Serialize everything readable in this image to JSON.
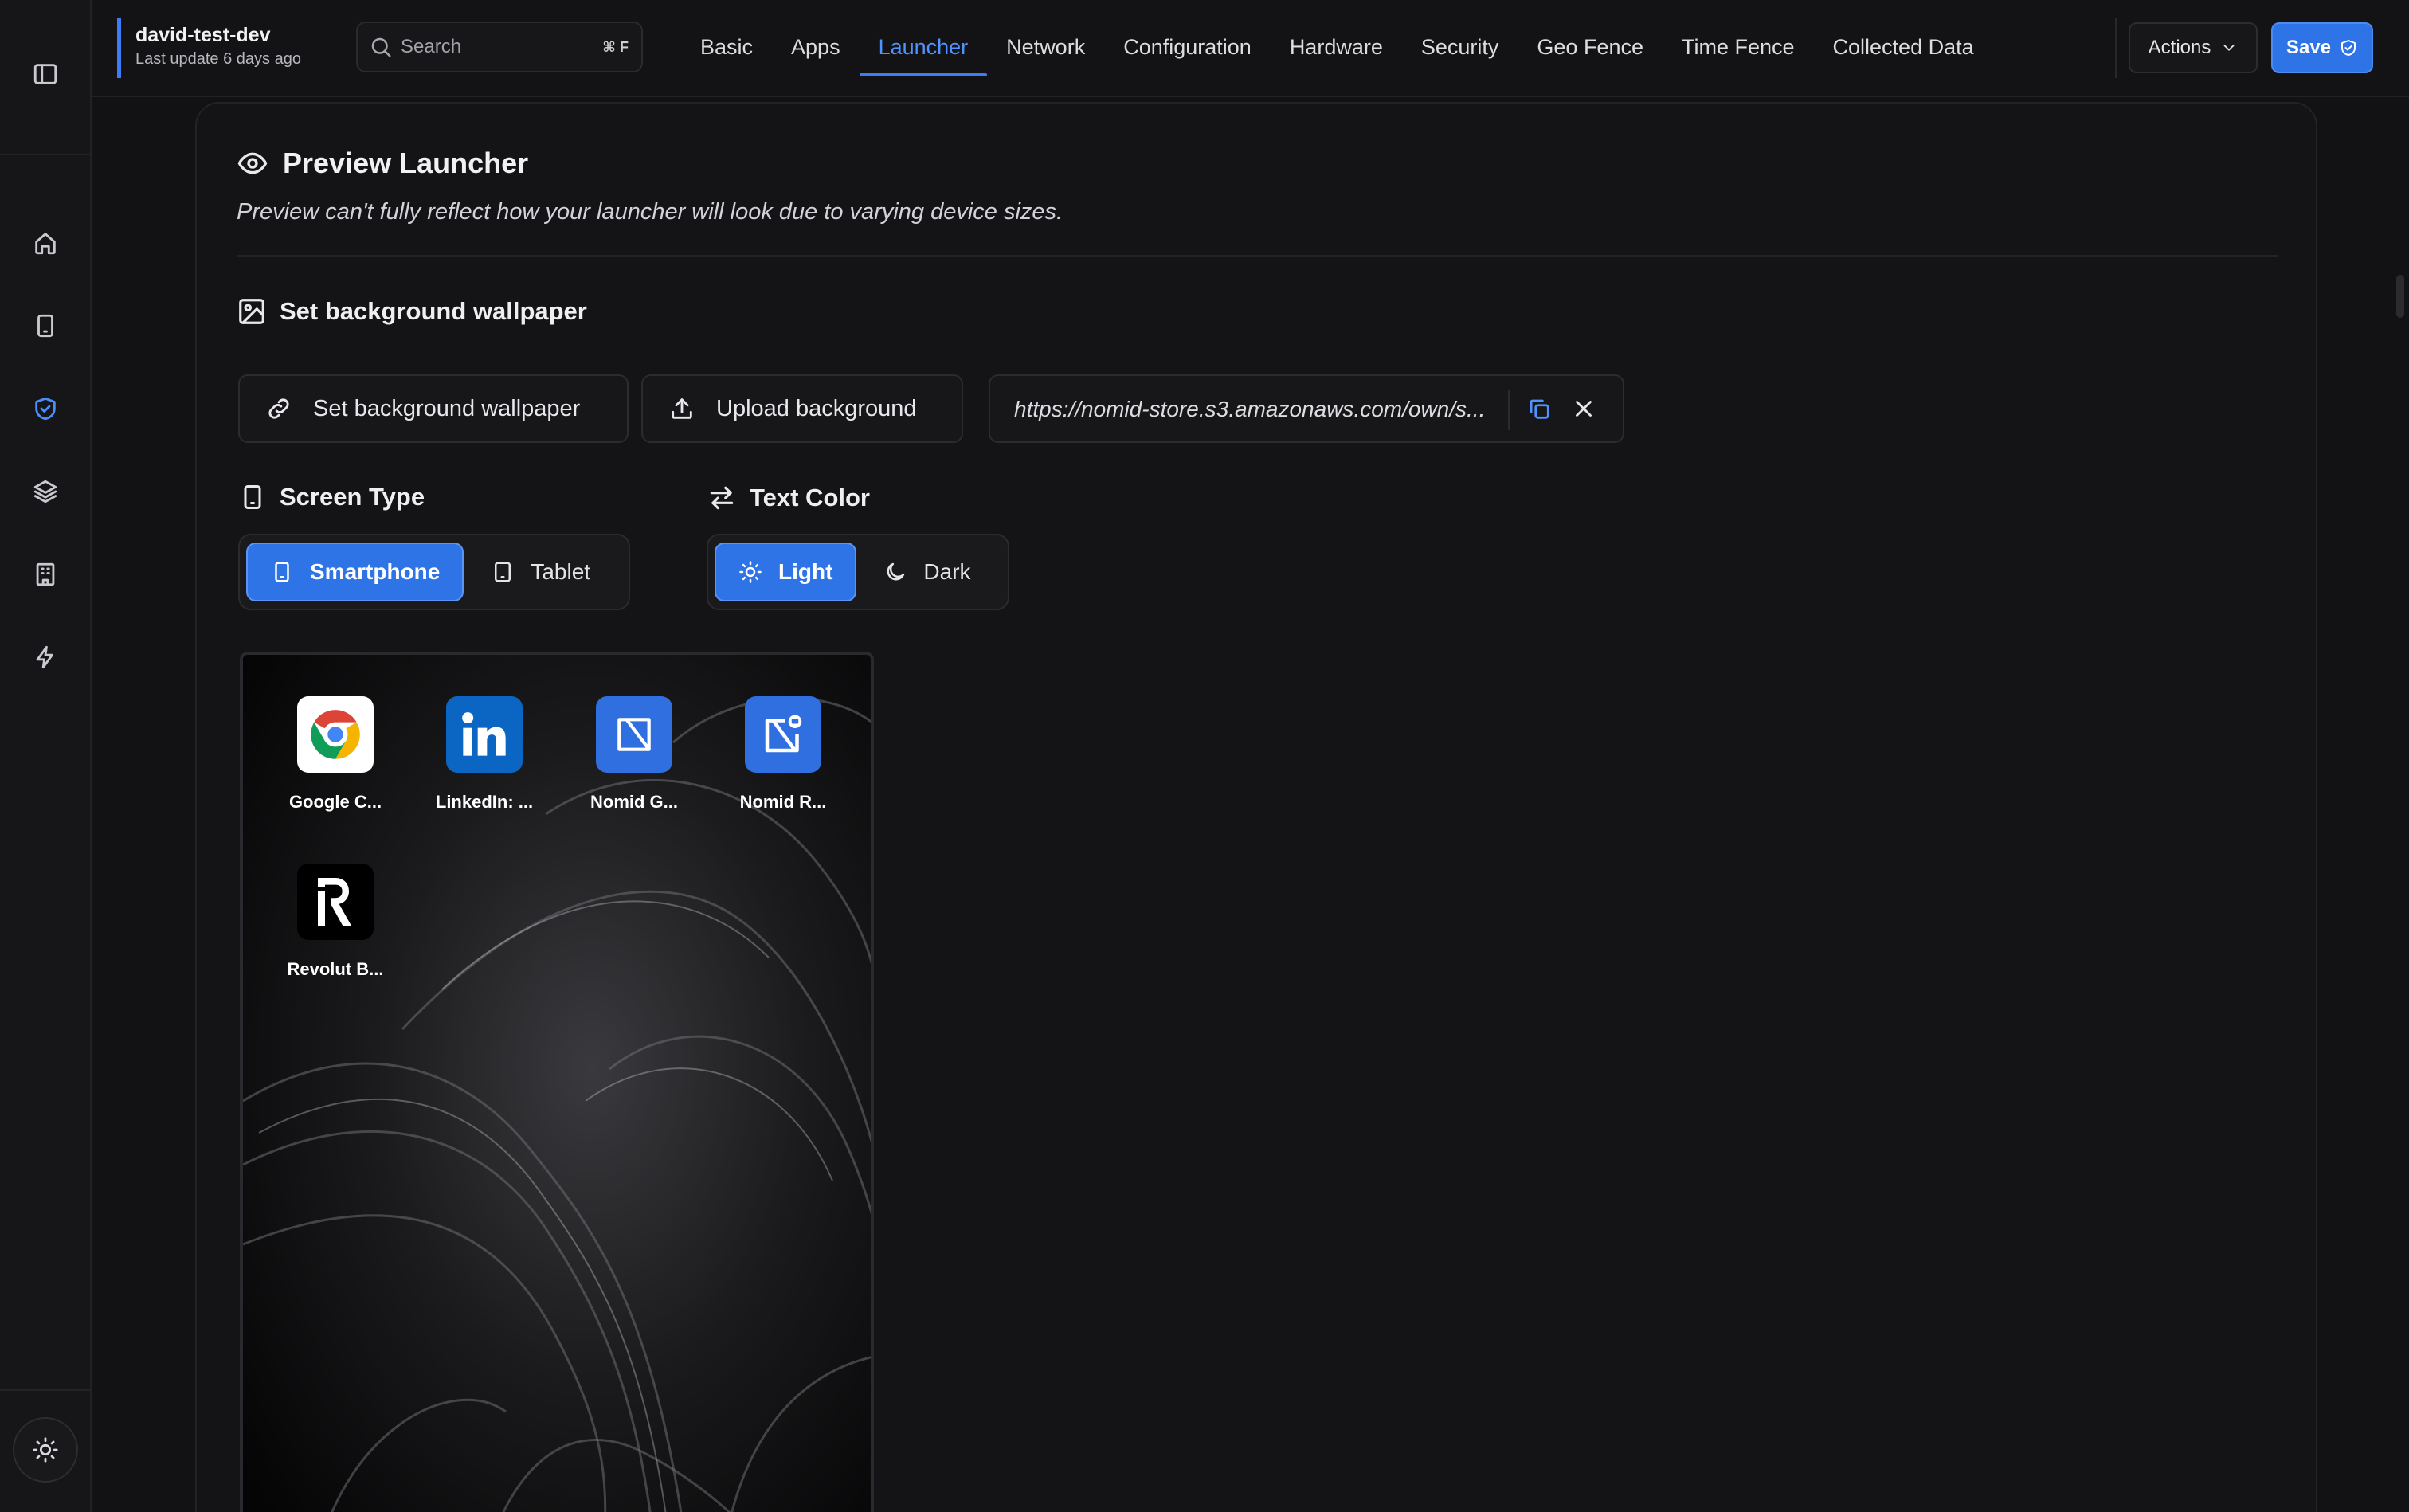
{
  "device": {
    "name": "david-test-dev",
    "last_update": "Last update 6 days ago"
  },
  "search": {
    "placeholder": "Search",
    "shortcut": "⌘ F"
  },
  "tabs": [
    {
      "label": "Basic"
    },
    {
      "label": "Apps"
    },
    {
      "label": "Launcher",
      "active": true
    },
    {
      "label": "Network"
    },
    {
      "label": "Configuration"
    },
    {
      "label": "Hardware"
    },
    {
      "label": "Security"
    },
    {
      "label": "Geo Fence"
    },
    {
      "label": "Time Fence"
    },
    {
      "label": "Collected Data"
    }
  ],
  "toolbar": {
    "actions_label": "Actions",
    "save_label": "Save"
  },
  "sidebar": {
    "items": [
      {
        "icon": "home-icon"
      },
      {
        "icon": "smartphone-icon"
      },
      {
        "icon": "shield-check-icon",
        "active": true
      },
      {
        "icon": "layers-icon"
      },
      {
        "icon": "building-icon"
      },
      {
        "icon": "lightning-icon"
      }
    ],
    "theme_icon": "sun-icon"
  },
  "preview": {
    "title": "Preview Launcher",
    "subtitle": "Preview can't fully reflect how your launcher will look due to varying device sizes."
  },
  "wallpaper": {
    "section_title": "Set background wallpaper",
    "set_button": "Set background wallpaper",
    "upload_button": "Upload background",
    "url": "https://nomid-store.s3.amazonaws.com/own/s..."
  },
  "screen_type": {
    "title": "Screen Type",
    "options": [
      {
        "label": "Smartphone",
        "selected": true
      },
      {
        "label": "Tablet",
        "selected": false
      }
    ]
  },
  "text_color": {
    "title": "Text Color",
    "options": [
      {
        "label": "Light",
        "selected": true
      },
      {
        "label": "Dark",
        "selected": false
      }
    ]
  },
  "apps": [
    {
      "label": "Google C...",
      "icon": "chrome-icon"
    },
    {
      "label": "LinkedIn: ...",
      "icon": "linkedin-icon"
    },
    {
      "label": "Nomid G...",
      "icon": "nomid-icon"
    },
    {
      "label": "Nomid R...",
      "icon": "nomid-remote-icon"
    },
    {
      "label": "Revolut B...",
      "icon": "revolut-icon"
    }
  ],
  "colors": {
    "accent": "#2f74e6",
    "active_tab": "#4f93ff",
    "background": "#121214",
    "linkedin": "#0a66c2",
    "nomid": "#2f6fe0"
  }
}
